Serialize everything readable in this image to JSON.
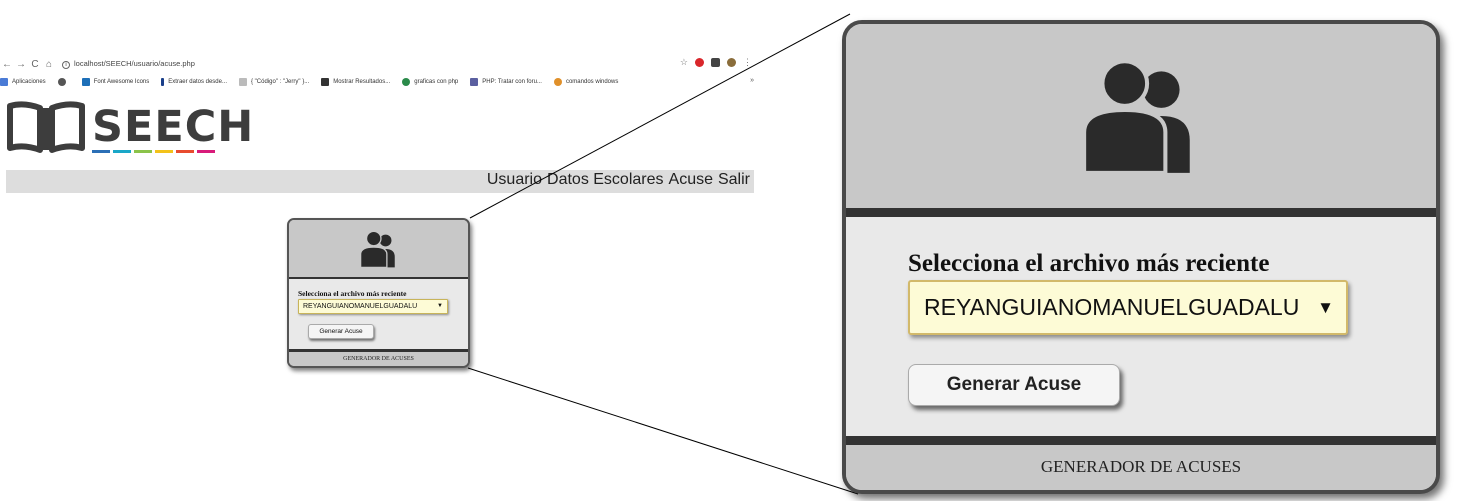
{
  "browser": {
    "nav": {
      "back": "←",
      "forward": "→",
      "reload": "C",
      "home": "⌂"
    },
    "url": "localhost/SEECH/usuario/acuse.php",
    "bookmarks": [
      {
        "label": "Aplicaciones",
        "color": "#4a7bd6"
      },
      {
        "label": "",
        "color": "#555555"
      },
      {
        "label": "Font Awesome Icons",
        "color": "#1d6fb8"
      },
      {
        "label": "Extraer datos desde...",
        "color": "#1a3f8a"
      },
      {
        "label": "{ \"Código\" : \"Jerry\" }...",
        "color": "#999999"
      },
      {
        "label": "Mostrar Resultados...",
        "color": "#333333"
      },
      {
        "label": "graficas con php",
        "color": "#2a8a4a"
      },
      {
        "label": "PHP: Tratar con foru...",
        "color": "#5b5fa0"
      },
      {
        "label": "comandos windows",
        "color": "#e0902a"
      }
    ],
    "bookmarks_more": "»"
  },
  "site": {
    "logo_text": "SEECH",
    "stripe_colors": [
      "#2b6fb6",
      "#1aa7c8",
      "#8bc34a",
      "#f3c21a",
      "#e84b2e",
      "#d81b7a"
    ]
  },
  "menu": {
    "items": [
      "Usuario",
      "Datos Escolares",
      "Acuse",
      "Salir"
    ]
  },
  "card": {
    "label": "Selecciona el archivo más reciente",
    "select_value": "REYANGUIANOMANUELGUADALU",
    "select_arrow": "▼",
    "button_label": "Generar Acuse",
    "footer": "GENERADOR DE ACUSES"
  },
  "icons": [
    "back-icon",
    "forward-icon",
    "reload-icon",
    "home-icon",
    "users-icon",
    "book-logo-icon",
    "star-icon",
    "dropdown-arrow-icon"
  ]
}
